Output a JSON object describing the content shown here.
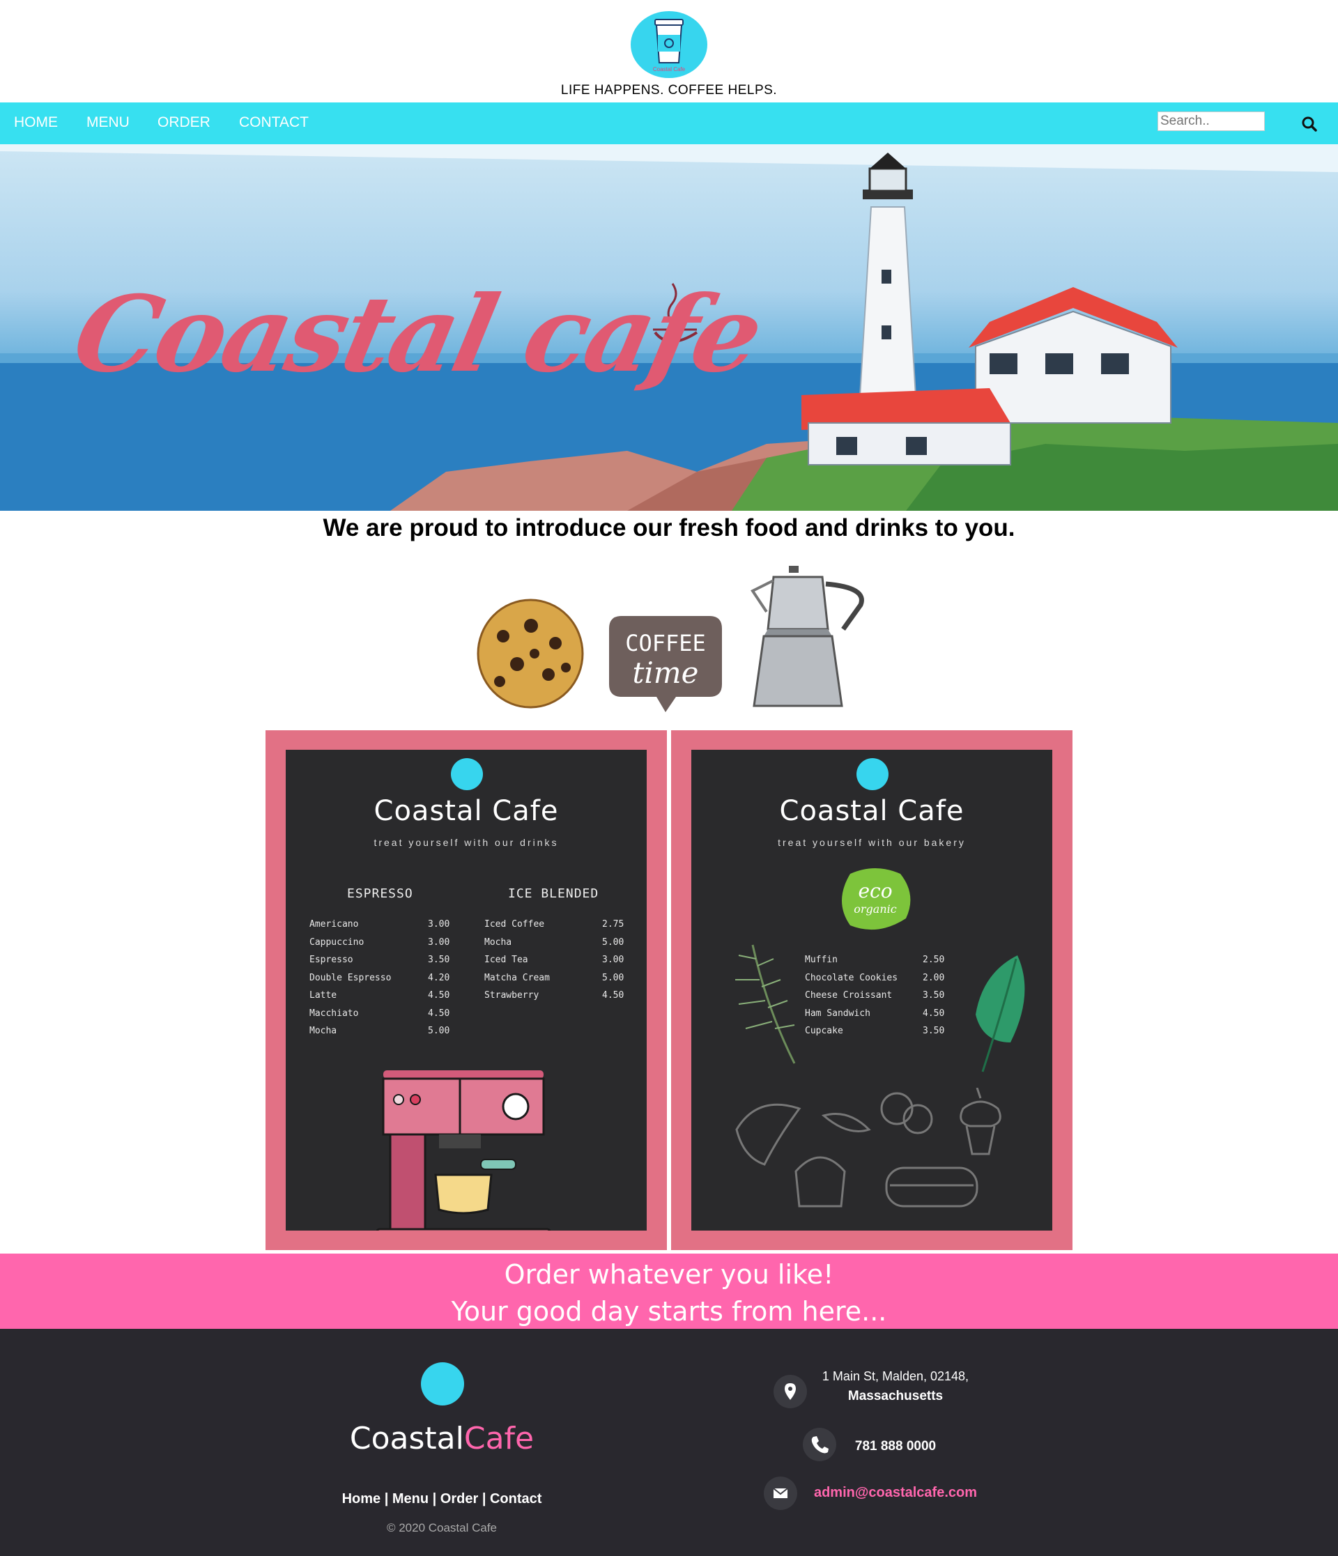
{
  "brand": {
    "logo_text": "Coastal Cafe",
    "tagline": "LIFE HAPPENS. COFFEE HELPS."
  },
  "nav": {
    "items": [
      "HOME",
      "MENU",
      "ORDER",
      "CONTACT"
    ],
    "search_placeholder": "Search..",
    "search_icon": "search-icon"
  },
  "hero": {
    "title": "Coastal cafe"
  },
  "intro": "We are proud to introduce our fresh food and drinks to you.",
  "decorations": {
    "coffee_bubble_text_1": "COFFEE",
    "coffee_bubble_text_2": "time"
  },
  "drinks_board": {
    "title": "Coastal Cafe",
    "subtitle": "treat yourself with our drinks",
    "espresso": {
      "heading": "ESPRESSO",
      "items": [
        {
          "name": "Americano",
          "price": "3.00"
        },
        {
          "name": "Cappuccino",
          "price": "3.00"
        },
        {
          "name": "Espresso",
          "price": "3.50"
        },
        {
          "name": "Double Espresso",
          "price": "4.20"
        },
        {
          "name": "Latte",
          "price": "4.50"
        },
        {
          "name": "Macchiato",
          "price": "4.50"
        },
        {
          "name": "Mocha",
          "price": "5.00"
        }
      ]
    },
    "ice_blended": {
      "heading": "ICE BLENDED",
      "items": [
        {
          "name": "Iced Coffee",
          "price": "2.75"
        },
        {
          "name": "Mocha",
          "price": "5.00"
        },
        {
          "name": "Iced Tea",
          "price": "3.00"
        },
        {
          "name": "Matcha Cream",
          "price": "5.00"
        },
        {
          "name": "Strawberry",
          "price": "4.50"
        }
      ]
    }
  },
  "bakery_board": {
    "title": "Coastal Cafe",
    "subtitle": "treat yourself with our bakery",
    "badge_1": "eco",
    "badge_2": "organic",
    "items": [
      {
        "name": "Muffin",
        "price": "2.50"
      },
      {
        "name": "Chocolate Cookies",
        "price": "2.00"
      },
      {
        "name": "Cheese Croissant",
        "price": "3.50"
      },
      {
        "name": "Ham Sandwich",
        "price": "4.50"
      },
      {
        "name": "Cupcake",
        "price": "3.50"
      }
    ]
  },
  "banner": {
    "line1": "Order whatever you like!",
    "line2": "Your good day starts from here..."
  },
  "footer": {
    "brand_part1": "Coastal",
    "brand_part2": "Cafe",
    "links": [
      "Home",
      "Menu",
      "Order",
      "Contact"
    ],
    "separator": " | ",
    "copyright": "© 2020 Coastal Cafe",
    "address_line1": "1 Main St, Malden, 02148,",
    "address_line2": "Massachusetts",
    "phone": "781 888 0000",
    "email": "admin@coastalcafe.com"
  },
  "colors": {
    "nav": "#37e0f0",
    "board_frame": "#e27185",
    "banner": "#ff66ad",
    "footer": "#29282e",
    "logo": "#37d5ee"
  }
}
